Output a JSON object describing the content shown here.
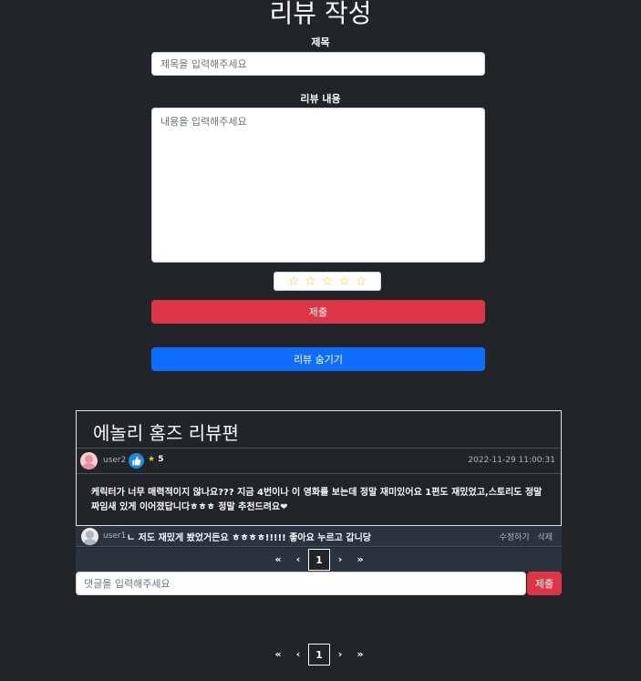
{
  "page": {
    "title": "리뷰 작성"
  },
  "form": {
    "title_label": "제목",
    "title_placeholder": "제목을 입력해주세요",
    "content_label": "리뷰 내용",
    "content_placeholder": "내용을 입력해주세요",
    "stars": [
      "☆",
      "☆",
      "☆",
      "☆",
      "☆"
    ],
    "submit_label": "제출",
    "hide_label": "리뷰 숨기기"
  },
  "review": {
    "title": "에놀리 홈즈 리뷰편",
    "user": "user2",
    "rating_star": "★",
    "rating": "5",
    "date": "2022-11-29 11:00:31",
    "body": "케릭터가 너무 매력적이지 않나요??? 지금 4번이나 이 영화를 보는데 정말 재미있어요 1편도 재밌었고,스토리도 정말 짜임새 있게 이어졌답니다ㅎㅎㅎ 정말 추천드려요❤"
  },
  "comment": {
    "user": "user1",
    "text": "ㄴ 저도 재밌게 봤었거든요 ㅎㅎㅎㅎ!!!!! 좋아요 누르고 갑니당",
    "edit_label": "수정하기",
    "delete_label": "삭제",
    "input_placeholder": "댓글을 입력해주세요",
    "submit_label": "제출"
  },
  "comment_pager": {
    "first": "«",
    "prev": "‹",
    "current": "1",
    "next": "›",
    "last": "»"
  },
  "review_pager": {
    "first": "«",
    "prev": "‹",
    "current": "1",
    "next": "›",
    "last": "»"
  },
  "colors": {
    "background": "#212529",
    "danger": "#dc3545",
    "primary": "#0d6efd",
    "star": "#f5c518"
  }
}
